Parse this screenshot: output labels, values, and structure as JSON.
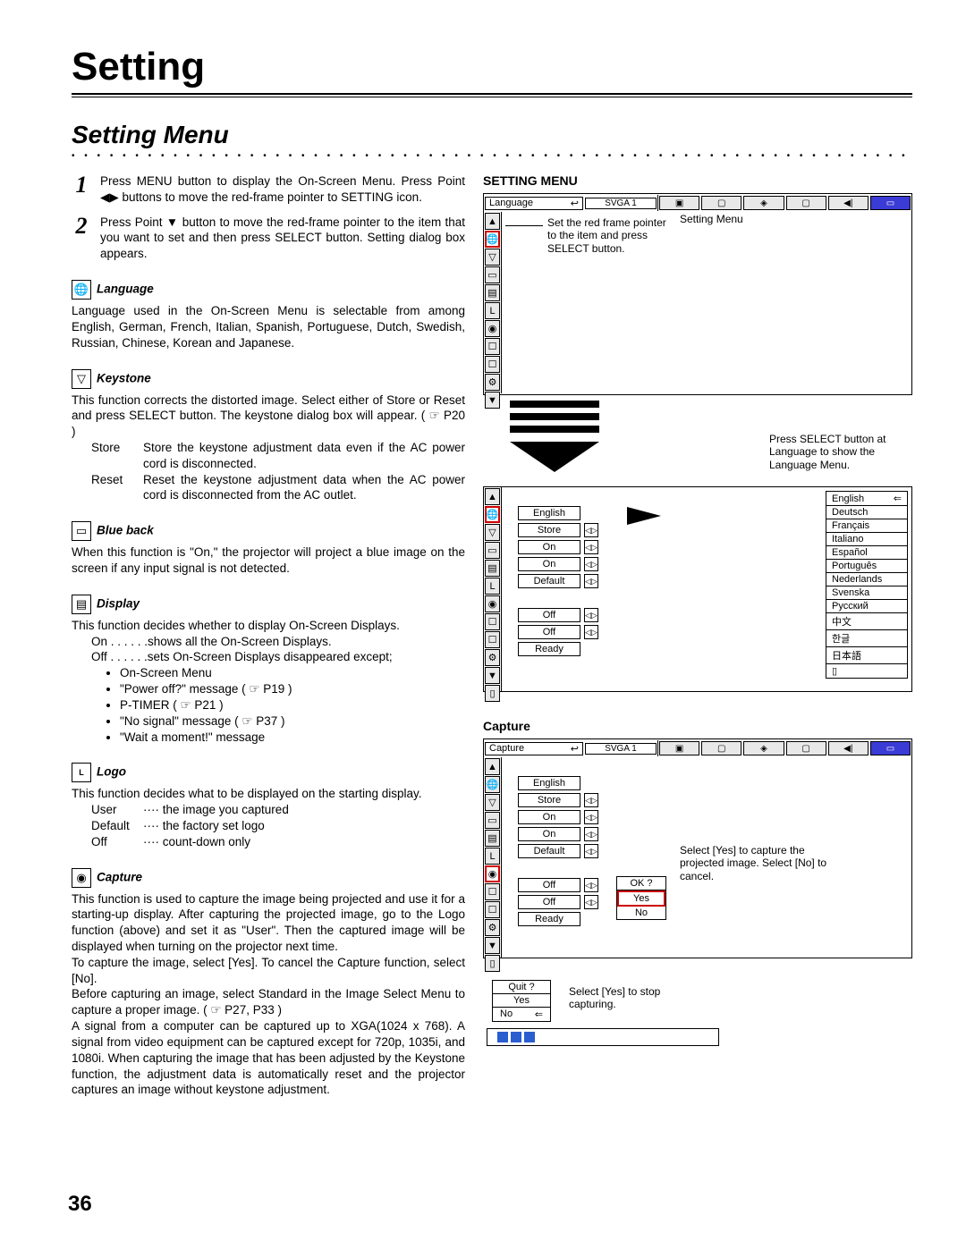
{
  "page": {
    "title": "Setting",
    "subtitle": "Setting Menu",
    "page_num": "36"
  },
  "step1": "Press MENU button to display the On-Screen Menu.  Press Point ◀▶ buttons to move the red-frame pointer to  SETTING icon.",
  "step2": "Press Point ▼ button to move the red-frame pointer to the item that you want to set and then press SELECT button.  Setting dialog box appears.",
  "sections": {
    "language_h": "Language",
    "language_p": "Language used in the On-Screen Menu is selectable from among English, German, French, Italian, Spanish, Portuguese, Dutch, Swedish, Russian, Chinese, Korean and Japanese.",
    "keystone_h": "Keystone",
    "keystone_p1": "This function corrects the distorted image. Select either of Store or Reset and press SELECT button. The keystone dialog box will appear. ( ☞ P20 )",
    "keystone_store_k": "Store",
    "keystone_store_v": "Store the keystone adjustment data even if the AC power cord is disconnected.",
    "keystone_reset_k": "Reset",
    "keystone_reset_v": "Reset the keystone adjustment data when the AC power cord is disconnected from the AC outlet.",
    "blueback_h": "Blue back",
    "blueback_p": "When this function is \"On,\" the projector will project a blue image on the screen if any input signal is not detected.",
    "display_h": "Display",
    "display_p": "This function decides whether to display On-Screen Displays.",
    "display_on": "On . . . . . .shows all the On-Screen Displays.",
    "display_off": "Off . . . . . .sets On-Screen Displays disappeared except;",
    "display_b1": "On-Screen Menu",
    "display_b2": "\"Power off?\" message ( ☞ P19 )",
    "display_b3": "P-TIMER ( ☞ P21 )",
    "display_b4": "\"No signal\" message ( ☞ P37 )",
    "display_b5": "\"Wait a moment!\" message",
    "logo_h": "Logo",
    "logo_p": "This function decides what to be displayed on the starting display.",
    "logo_user_k": "User",
    "logo_user_v": "···· the image you captured",
    "logo_default_k": "Default",
    "logo_default_v": "···· the factory set logo",
    "logo_off_k": "Off",
    "logo_off_v": "···· count-down only",
    "capture_h": "Capture",
    "capture_p1": "This function is used to capture the image being projected and use it for a starting-up display.  After capturing the projected image, go to the Logo function (above) and set it as \"User\".  Then the captured image will be displayed when turning on the projector next time.",
    "capture_p2": "To capture the image, select [Yes].  To cancel the Capture function, select [No].",
    "capture_p3": "Before capturing an image, select Standard in the Image Select Menu to capture a proper image.  ( ☞ P27, P33 )",
    "capture_p4": "A signal from a computer can be captured up to XGA(1024 x 768).  A signal from video equipment can be captured except for 720p, 1035i, and 1080i. When capturing the image that has been adjusted by the Keystone function, the adjustment data is automatically reset and the projector captures an image without keystone adjustment."
  },
  "right": {
    "heading1": "SETTING MENU",
    "top_label": "Language",
    "svga": "SVGA 1",
    "annot_setframe": "Set the red frame pointer to the item and press SELECT button.",
    "annot_setting_menu": "Setting Menu",
    "annot_press_select": "Press SELECT button at Language to show the Language Menu.",
    "values": {
      "v0": "English",
      "v1": "Store",
      "v2": "On",
      "v3": "On",
      "v4": "Default",
      "v5": "Off",
      "v6": "Off",
      "v7": "Ready"
    },
    "languages": [
      "English",
      "Deutsch",
      "Français",
      "Italiano",
      "Español",
      "Português",
      "Nederlands",
      "Svenska",
      "Русский",
      "中文",
      "한글",
      "日本語"
    ],
    "heading2": "Capture",
    "top_label2": "Capture",
    "dlg_ok": "OK ?",
    "dlg_yes": "Yes",
    "dlg_no": "No",
    "annot_capture": "Select [Yes] to capture the projected image. Select [No] to cancel.",
    "quit": "Quit ?",
    "quit_yes": "Yes",
    "quit_no": "No",
    "annot_quit": "Select [Yes] to stop capturing."
  }
}
